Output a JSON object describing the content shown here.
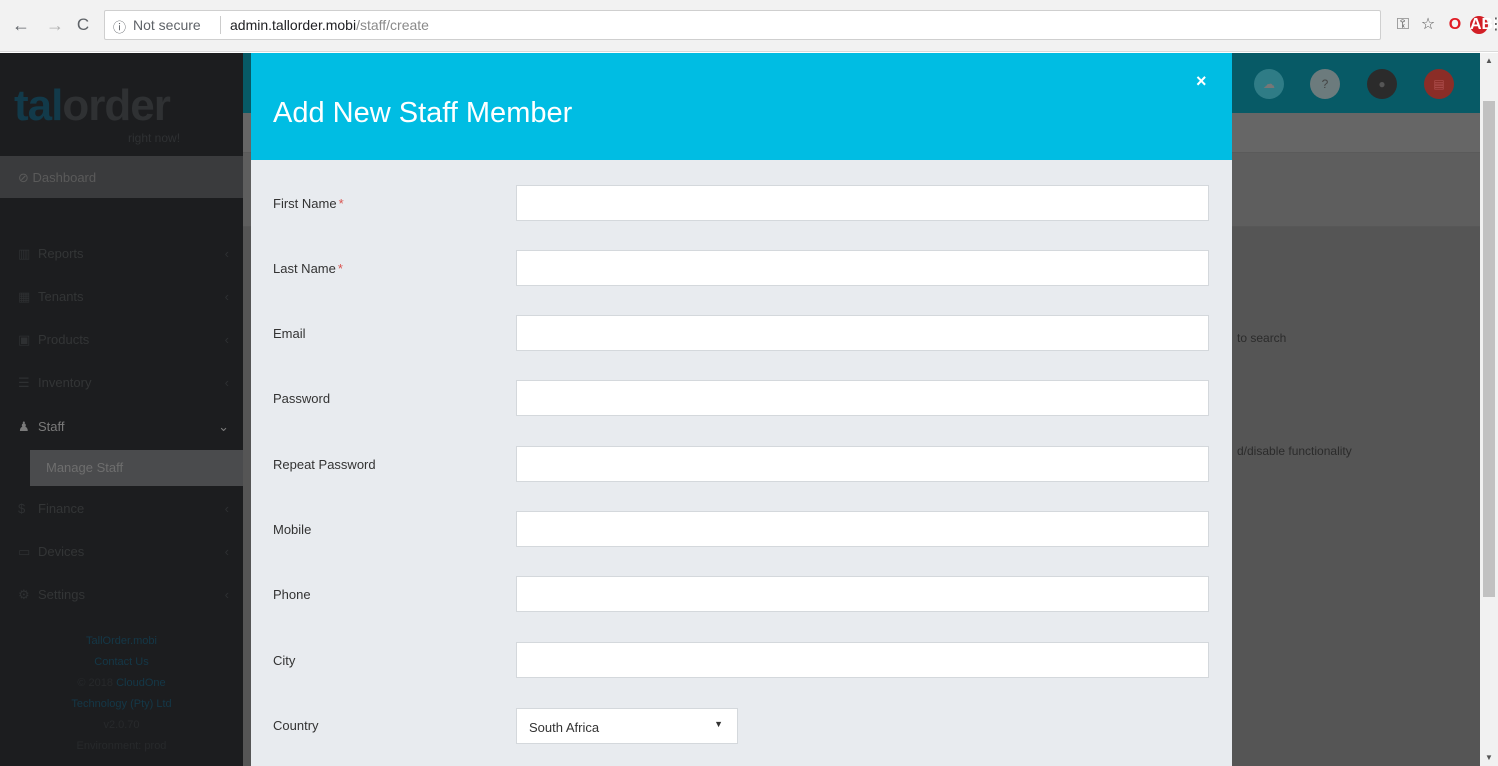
{
  "browser": {
    "security_icon": "info-icon",
    "security_text": "Not secure",
    "url_host": "admin.tallorder.mobi",
    "url_path": "/staff/create"
  },
  "sidebar": {
    "logo_main_a": "tal",
    "logo_main_b": "order",
    "logo_sub": "right now!",
    "dashboard": "Dashboard",
    "items": [
      {
        "label": "Reports",
        "icon": "bar-chart-icon"
      },
      {
        "label": "Tenants",
        "icon": "building-icon"
      },
      {
        "label": "Products",
        "icon": "cube-icon"
      },
      {
        "label": "Inventory",
        "icon": "list-icon"
      },
      {
        "label": "Staff",
        "icon": "users-icon"
      },
      {
        "label": "Manage Staff"
      },
      {
        "label": "Finance",
        "icon": "money-icon"
      },
      {
        "label": "Devices",
        "icon": "tablet-icon"
      },
      {
        "label": "Settings",
        "icon": "gear-icon"
      }
    ],
    "footer": {
      "link1": "TallOrder.mobi",
      "link2": "Contact Us",
      "copyright_prefix": "© 2018",
      "company_a": "CloudOne",
      "company_b": "Technology (Pty) Ltd",
      "version": "v2.0.70",
      "environment": "Environment: prod"
    }
  },
  "background": {
    "text1": "to search",
    "text2": "d/disable functionality"
  },
  "modal": {
    "title": "Add New Staff Member",
    "close": "×",
    "fields": [
      {
        "label": "First Name",
        "required": "*",
        "value": ""
      },
      {
        "label": "Last Name",
        "required": "*",
        "value": ""
      },
      {
        "label": "Email",
        "value": ""
      },
      {
        "label": "Password",
        "value": ""
      },
      {
        "label": "Repeat Password",
        "value": ""
      },
      {
        "label": "Mobile",
        "value": ""
      },
      {
        "label": "Phone",
        "value": ""
      },
      {
        "label": "City",
        "value": ""
      }
    ],
    "country": {
      "label": "Country",
      "value": "South Africa"
    }
  },
  "colors": {
    "modal_header": "#00bde3",
    "topbar": "#075a66",
    "required": "#d9534f"
  }
}
